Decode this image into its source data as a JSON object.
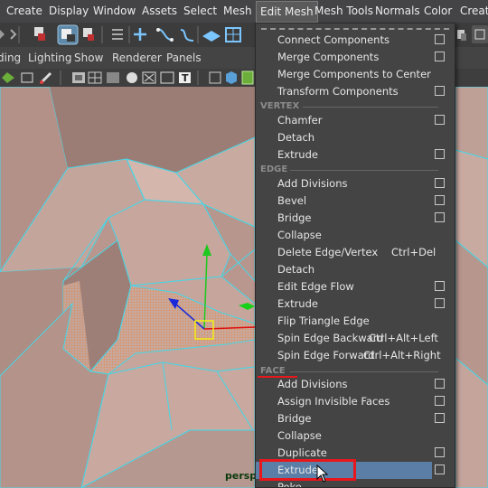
{
  "menubar": {
    "items": [
      "Create",
      "Display",
      "Window",
      "Assets",
      "Select",
      "Mesh",
      "Edit Mesh",
      "Mesh Tools",
      "Normals",
      "Color",
      "Create"
    ],
    "active": "Edit Mesh"
  },
  "panel_menu": {
    "items": [
      "ding",
      "Lighting",
      "Show",
      "Renderer",
      "Panels"
    ]
  },
  "viewport": {
    "label": "persp"
  },
  "edit_mesh_menu": {
    "top_items": [
      {
        "label": "Connect Components",
        "option": true
      },
      {
        "label": "Merge Components",
        "option": true
      },
      {
        "label": "Merge Components to Center",
        "option": false
      },
      {
        "label": "Transform Components",
        "option": true
      }
    ],
    "vertex_title": "VERTEX",
    "vertex_items": [
      {
        "label": "Chamfer",
        "option": true
      },
      {
        "label": "Detach",
        "option": false
      },
      {
        "label": "Extrude",
        "option": true
      }
    ],
    "edge_title": "EDGE",
    "edge_items": [
      {
        "label": "Add Divisions",
        "option": true
      },
      {
        "label": "Bevel",
        "option": true
      },
      {
        "label": "Bridge",
        "option": true
      },
      {
        "label": "Collapse",
        "option": false
      },
      {
        "label": "Delete Edge/Vertex",
        "shortcut": "Ctrl+Del",
        "option": false
      },
      {
        "label": "Detach",
        "option": false
      },
      {
        "label": "Edit Edge Flow",
        "option": true
      },
      {
        "label": "Extrude",
        "option": true
      },
      {
        "label": "Flip Triangle Edge",
        "option": false
      },
      {
        "label": "Spin Edge Backward",
        "shortcut": "Ctrl+Alt+Left",
        "option": false
      },
      {
        "label": "Spin Edge Forward",
        "shortcut": "Ctrl+Alt+Right",
        "option": false
      }
    ],
    "face_title": "FACE",
    "face_items": [
      {
        "label": "Add Divisions",
        "option": true
      },
      {
        "label": "Assign Invisible Faces",
        "option": true
      },
      {
        "label": "Bridge",
        "option": true
      },
      {
        "label": "Collapse",
        "option": false
      },
      {
        "label": "Duplicate",
        "option": true
      },
      {
        "label": "Extrude",
        "option": true
      },
      {
        "label": "Poke",
        "option": false
      }
    ],
    "highlighted": "Extrude"
  },
  "colors": {
    "menu_bg": "#444444",
    "highlight": "#5a7ea6",
    "annotation_red": "#e8171c",
    "mesh_face": "#c1a39a",
    "mesh_wire": "#45d7e8"
  }
}
